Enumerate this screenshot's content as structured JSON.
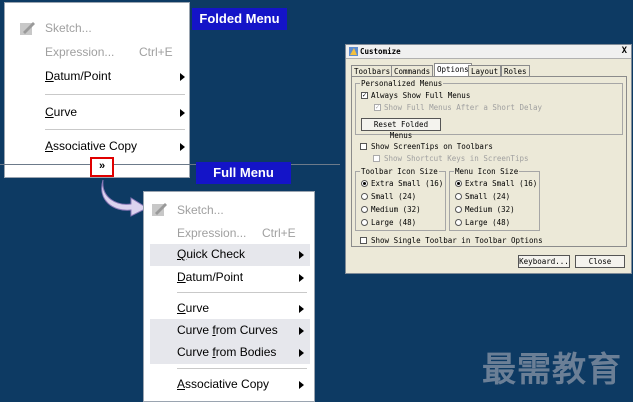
{
  "folded_menu": {
    "tag": "Folded Menu",
    "items": {
      "sketch": "Sketch...",
      "expression": "Expression...",
      "expression_shortcut": "Ctrl+E",
      "datum_point_a": "D",
      "datum_point_b": "atum/Point",
      "curve_a": "C",
      "curve_b": "urve",
      "assoc_a": "A",
      "assoc_b": "ssociative Copy"
    },
    "expand_glyph": "»"
  },
  "full_menu": {
    "tag": "Full Menu",
    "items": {
      "sketch": "Sketch...",
      "expression": "Expression...",
      "expression_shortcut": "Ctrl+E",
      "quick_check_a": "Q",
      "quick_check_b": "uick Check",
      "datum_point_a": "D",
      "datum_point_b": "atum/Point",
      "curve_a": "C",
      "curve_b": "urve",
      "curve_from_curves_a": "Curve ",
      "curve_from_curves_b": "f",
      "curve_from_curves_c": "rom Curves",
      "curve_from_bodies_a": "Curve ",
      "curve_from_bodies_b": "f",
      "curve_from_bodies_c": "rom Bodies",
      "assoc_a": "A",
      "assoc_b": "ssociative Copy"
    }
  },
  "customize_dialog": {
    "title": "Customize",
    "close": "X",
    "tabs": [
      "Toolbars",
      "Commands",
      "Options",
      "Layout",
      "Roles"
    ],
    "active_tab": "Options",
    "personalized_menus": {
      "title": "Personalized Menus",
      "always_show": "Always Show Full Menus",
      "show_after_delay": "Show Full Menus After a Short Delay",
      "reset_button": "Reset Folded Menus"
    },
    "show_screentips": "Show ScreenTips on Toolbars",
    "show_shortcut_keys": "Show Shortcut Keys in ScreenTips",
    "toolbar_icon_size": {
      "title": "Toolbar Icon Size",
      "options": [
        "Extra Small (16)",
        "Small (24)",
        "Medium (32)",
        "Large (48)"
      ]
    },
    "menu_icon_size": {
      "title": "Menu Icon Size",
      "options": [
        "Extra Small (16)",
        "Small (24)",
        "Medium (32)",
        "Large (48)"
      ]
    },
    "single_toolbar": "Show Single Toolbar in Toolbar Options",
    "keyboard_button": "Keyboard...",
    "close_button": "Close"
  },
  "watermark": "最需教育"
}
